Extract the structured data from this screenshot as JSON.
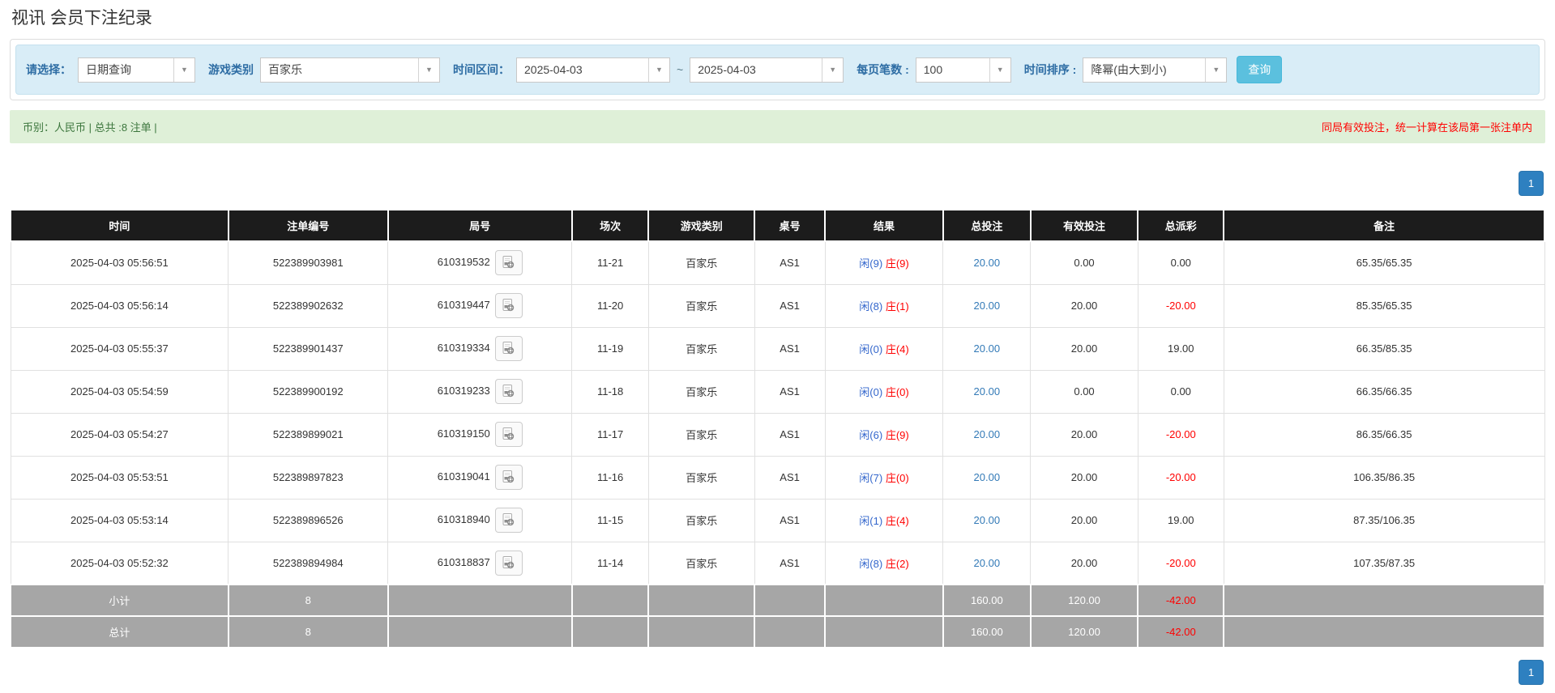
{
  "page": {
    "title": "视讯 会员下注纪录"
  },
  "filters": {
    "select_type": {
      "label": "请选择：",
      "value": "日期查询"
    },
    "game_category": {
      "label": "游戏类别",
      "value": "百家乐"
    },
    "time_range": {
      "label": "时间区间：",
      "from": "2025-04-03",
      "separator": "~",
      "to": "2025-04-03"
    },
    "page_size": {
      "label": "每页笔数 :",
      "value": "100"
    },
    "time_sort": {
      "label": "时间排序 :",
      "value": "降幂(由大到小)"
    },
    "search_button": "查询"
  },
  "summary": {
    "left": "币别：人民币 | 总共 :8 注单 |",
    "right_note": "同局有效投注，统一计算在该局第一张注单内"
  },
  "pagination": {
    "page": "1"
  },
  "colors": {
    "accent_link_blue": "#337ab7",
    "result_player_blue": "#3366cc",
    "result_banker_red": "#ff0000",
    "negative_red": "#ff0000",
    "query_button_blue": "#5bc0de",
    "pager_blue": "#2e80c0",
    "header_bg": "#1c1c1c",
    "totals_bg": "#a6a6a6",
    "filter_bg": "#d9edf7",
    "summary_bg": "#dff0d8",
    "summary_green": "#3c763d"
  },
  "table": {
    "headers": [
      "时间",
      "注单编号",
      "局号",
      "场次",
      "游戏类别",
      "桌号",
      "结果",
      "总投注",
      "有效投注",
      "总派彩",
      "备注"
    ],
    "rows": [
      {
        "time": "2025-04-03 05:56:51",
        "bet_id": "522389903981",
        "round_id": "610319532",
        "session": "11-21",
        "game": "百家乐",
        "table_no": "AS1",
        "result_player": "闲(9)",
        "result_banker": "庄(9)",
        "total_bet": "20.00",
        "valid_bet": "0.00",
        "payout": "0.00",
        "note": "65.35/65.35"
      },
      {
        "time": "2025-04-03 05:56:14",
        "bet_id": "522389902632",
        "round_id": "610319447",
        "session": "11-20",
        "game": "百家乐",
        "table_no": "AS1",
        "result_player": "闲(8)",
        "result_banker": "庄(1)",
        "total_bet": "20.00",
        "valid_bet": "20.00",
        "payout": "-20.00",
        "note": "85.35/65.35"
      },
      {
        "time": "2025-04-03 05:55:37",
        "bet_id": "522389901437",
        "round_id": "610319334",
        "session": "11-19",
        "game": "百家乐",
        "table_no": "AS1",
        "result_player": "闲(0)",
        "result_banker": "庄(4)",
        "total_bet": "20.00",
        "valid_bet": "20.00",
        "payout": "19.00",
        "note": "66.35/85.35"
      },
      {
        "time": "2025-04-03 05:54:59",
        "bet_id": "522389900192",
        "round_id": "610319233",
        "session": "11-18",
        "game": "百家乐",
        "table_no": "AS1",
        "result_player": "闲(0)",
        "result_banker": "庄(0)",
        "total_bet": "20.00",
        "valid_bet": "0.00",
        "payout": "0.00",
        "note": "66.35/66.35"
      },
      {
        "time": "2025-04-03 05:54:27",
        "bet_id": "522389899021",
        "round_id": "610319150",
        "session": "11-17",
        "game": "百家乐",
        "table_no": "AS1",
        "result_player": "闲(6)",
        "result_banker": "庄(9)",
        "total_bet": "20.00",
        "valid_bet": "20.00",
        "payout": "-20.00",
        "note": "86.35/66.35"
      },
      {
        "time": "2025-04-03 05:53:51",
        "bet_id": "522389897823",
        "round_id": "610319041",
        "session": "11-16",
        "game": "百家乐",
        "table_no": "AS1",
        "result_player": "闲(7)",
        "result_banker": "庄(0)",
        "total_bet": "20.00",
        "valid_bet": "20.00",
        "payout": "-20.00",
        "note": "106.35/86.35"
      },
      {
        "time": "2025-04-03 05:53:14",
        "bet_id": "522389896526",
        "round_id": "610318940",
        "session": "11-15",
        "game": "百家乐",
        "table_no": "AS1",
        "result_player": "闲(1)",
        "result_banker": "庄(4)",
        "total_bet": "20.00",
        "valid_bet": "20.00",
        "payout": "19.00",
        "note": "87.35/106.35"
      },
      {
        "time": "2025-04-03 05:52:32",
        "bet_id": "522389894984",
        "round_id": "610318837",
        "session": "11-14",
        "game": "百家乐",
        "table_no": "AS1",
        "result_player": "闲(8)",
        "result_banker": "庄(2)",
        "total_bet": "20.00",
        "valid_bet": "20.00",
        "payout": "-20.00",
        "note": "107.35/87.35"
      }
    ],
    "subtotal": {
      "label": "小计",
      "count": "8",
      "total_bet": "160.00",
      "valid_bet": "120.00",
      "payout": "-42.00"
    },
    "total": {
      "label": "总计",
      "count": "8",
      "total_bet": "160.00",
      "valid_bet": "120.00",
      "payout": "-42.00"
    }
  }
}
